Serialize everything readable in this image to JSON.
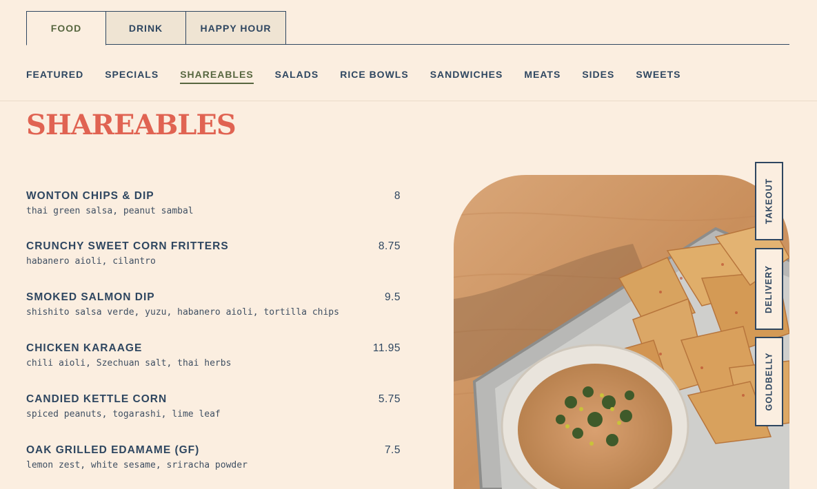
{
  "top_tabs": [
    {
      "label": "FOOD",
      "active": true
    },
    {
      "label": "DRINK",
      "active": false
    },
    {
      "label": "HAPPY HOUR",
      "active": false
    }
  ],
  "sub_nav": [
    {
      "label": "FEATURED"
    },
    {
      "label": "SPECIALS"
    },
    {
      "label": "SHAREABLES",
      "active": true
    },
    {
      "label": "SALADS"
    },
    {
      "label": "RICE BOWLS"
    },
    {
      "label": "SANDWICHES"
    },
    {
      "label": "MEATS"
    },
    {
      "label": "SIDES"
    },
    {
      "label": "SWEETS"
    }
  ],
  "section_title": "SHAREABLES",
  "menu_items": [
    {
      "name": "WONTON CHIPS & DIP",
      "price": "8",
      "desc": "thai green salsa, peanut sambal"
    },
    {
      "name": "CRUNCHY SWEET CORN FRITTERS",
      "price": "8.75",
      "desc": "habanero aioli, cilantro"
    },
    {
      "name": "SMOKED SALMON DIP",
      "price": "9.5",
      "desc": "shishito salsa verde, yuzu, habanero aioli, tortilla chips"
    },
    {
      "name": "CHICKEN KARAAGE",
      "price": "11.95",
      "desc": "chili aioli, Szechuan salt, thai herbs"
    },
    {
      "name": "CANDIED KETTLE CORN",
      "price": "5.75",
      "desc": "spiced peanuts, togarashi, lime leaf"
    },
    {
      "name": "OAK GRILLED EDAMAME (GF)",
      "price": "7.5",
      "desc": "lemon zest, white sesame, sriracha powder"
    }
  ],
  "side_buttons": [
    {
      "label": "TAKEOUT"
    },
    {
      "label": "DELIVERY"
    },
    {
      "label": "GOLDBELLY"
    }
  ],
  "colors": {
    "background": "#fbeee0",
    "navy": "#2e4660",
    "olive": "#57663f",
    "coral": "#e06352"
  }
}
